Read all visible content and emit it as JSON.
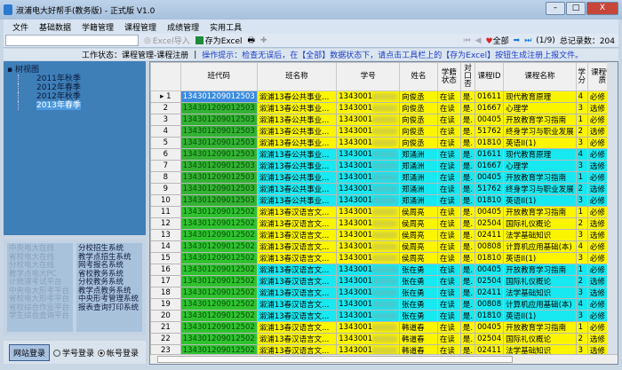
{
  "window": {
    "title": "淑浦电大好帮手(教务版) - 正式版 V1.0",
    "controls": [
      "–",
      "□",
      "X"
    ]
  },
  "menu": [
    "文件",
    "基础数据",
    "学籍管理",
    "课程管理",
    "成绩管理",
    "实用工具"
  ],
  "toolbar": {
    "search_value": "",
    "excel_import": "Excel导入",
    "save_excel": "存为Excel",
    "all": "全部",
    "page": "(1/9)",
    "total": "总记录数：204"
  },
  "status": {
    "work_state": "工作状态：课程管理-课程注册",
    "separator": "|",
    "hint": "操作提示：检查无误后，在【全部】数据状态下，请点击工具栏上的【存为Excel】按钮生成注册上报文件。"
  },
  "tree": {
    "root": "树视图",
    "items": [
      "2011年秋季",
      "2012年春季",
      "2012年秋季",
      "2013年春季"
    ],
    "selected": 3
  },
  "links_left": [
    "中央电大在线",
    "省校电大在线",
    "分校电大在线",
    "教学点电大PC",
    "计统课考试平台",
    "中央电大形考平台",
    "省校电大形考平台",
    "省校综合作业平台",
    "学生综合查询平台"
  ],
  "links_right": [
    "分校招生系统",
    "教学点招生系统",
    "网考报名系统",
    "省校教务系统",
    "分校教务系统",
    "教学点教务系统",
    "中央形考管理系统",
    "报表查询打印系统"
  ],
  "login": {
    "button": "网站登录",
    "opt1": "学号登录",
    "opt2": "帐号登录",
    "selected": "opt2"
  },
  "colors": {
    "yellow": "#fbf500",
    "cyan": "#18e8f0",
    "green": "#2fc22f"
  },
  "grid": {
    "columns": [
      "",
      "班代码",
      "班名称",
      "学号",
      "姓名",
      "学籍状态",
      "对口否",
      "课程ID",
      "课程名称",
      "学分",
      "课程性质"
    ],
    "groups": [
      {
        "code": "134301209012503",
        "cls": "溆浦13春公共事业...",
        "sid": "1343001",
        "name": "向俊丞",
        "courses": "A",
        "color": "y"
      },
      {
        "code": "134301209012503",
        "cls": "溆浦13春公共事业...",
        "sid": "1343001",
        "name": "郑涌洲",
        "courses": "A",
        "color": "c"
      },
      {
        "code": "134301209012502",
        "cls": "溆浦13春汉语言文...",
        "sid": "1343001",
        "name": "侯周亮",
        "courses": "B",
        "color": "y"
      },
      {
        "code": "134301209012502",
        "cls": "溆浦13春汉语言文...",
        "sid": "1343001",
        "name": "张在勇",
        "courses": "B",
        "color": "c"
      },
      {
        "code": "134301209012502",
        "cls": "溆浦13春汉语言文...",
        "sid": "1343001",
        "name": "韩道春",
        "courses": "B",
        "color": "y"
      }
    ],
    "status_val": "在读",
    "match_prefix": "是.",
    "course_sets": {
      "A": [
        [
          "01611",
          "现代教育原理",
          "4",
          "必修"
        ],
        [
          "01667",
          "心理学",
          "3",
          "选修"
        ],
        [
          "00405",
          "开放教育学习指南",
          "1",
          "必修"
        ],
        [
          "51762",
          "终身学习与职业发展",
          "2",
          "选修"
        ],
        [
          "01810",
          "英语II(1)",
          "3",
          "必修"
        ]
      ],
      "B": [
        [
          "00405",
          "开放教育学习指南",
          "1",
          "必修"
        ],
        [
          "02504",
          "国际礼仪概论",
          "2",
          "选修"
        ],
        [
          "02411",
          "法学基础知识",
          "3",
          "选修"
        ],
        [
          "00808",
          "计算机应用基础(本)",
          "4",
          "必修"
        ],
        [
          "01810",
          "英语II(1)",
          "3",
          "必修"
        ]
      ]
    }
  }
}
